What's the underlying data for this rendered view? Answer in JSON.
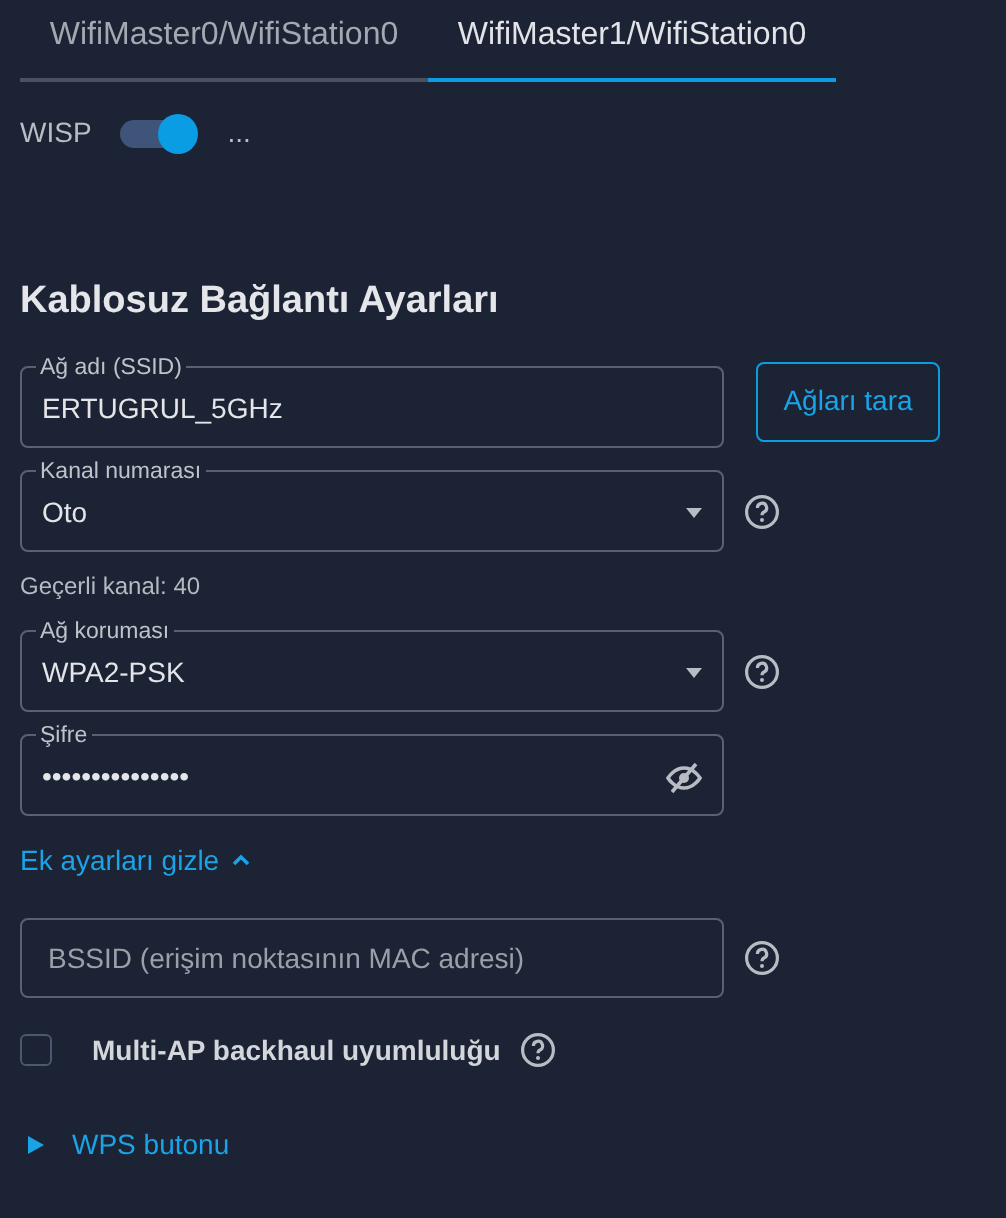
{
  "tabs": [
    {
      "label": "WifiMaster0/WifiStation0",
      "selected": false
    },
    {
      "label": "WifiMaster1/WifiStation0",
      "selected": true
    }
  ],
  "wisp": {
    "label": "WISP",
    "on": true,
    "note": "..."
  },
  "heading": "Kablosuz Bağlantı Ayarları",
  "fields": [
    {
      "kind": "text",
      "label": "Ağ adı (SSID)",
      "value": "ERTUGRUL_5GHz",
      "button": "Ağları tara"
    },
    {
      "kind": "select",
      "label": "Kanal numarası",
      "value": "Oto",
      "help": true,
      "hint": "Geçerli kanal: 40"
    },
    {
      "kind": "select",
      "label": "Ağ koruması",
      "value": "WPA2-PSK",
      "help": true
    },
    {
      "kind": "password",
      "label": "Şifre",
      "value": "•••••••••••••••"
    }
  ],
  "advanced": {
    "label": "Ek ayarları gizle",
    "expanded": true
  },
  "bssid": {
    "placeholder": "BSSID (erişim noktasının MAC adresi)",
    "help": true
  },
  "multi_ap": {
    "label": "Multi-AP backhaul uyumluluğu",
    "checked": false,
    "help": true
  },
  "wps": {
    "label": "WPS butonu",
    "expanded": false
  }
}
